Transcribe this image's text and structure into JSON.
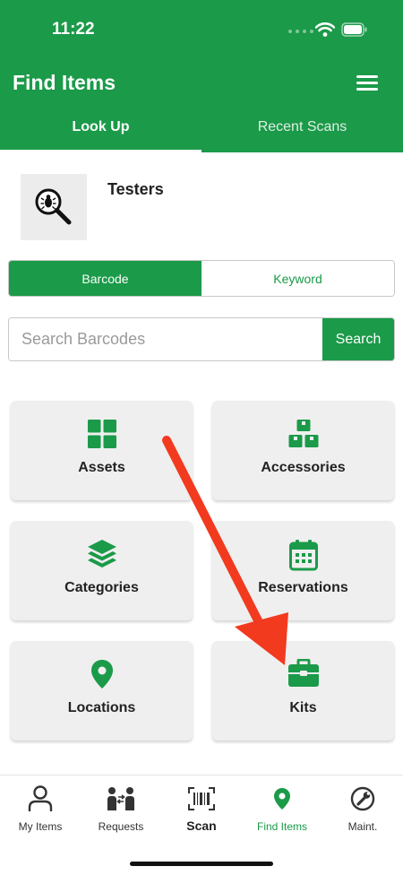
{
  "status_bar": {
    "time": "11:22"
  },
  "header": {
    "title": "Find Items"
  },
  "tabs": [
    {
      "label": "Look Up",
      "active": true
    },
    {
      "label": "Recent Scans",
      "active": false
    }
  ],
  "organization": {
    "name": "Testers",
    "icon": "bug-magnifier-icon"
  },
  "segment": [
    {
      "label": "Barcode",
      "active": true
    },
    {
      "label": "Keyword",
      "active": false
    }
  ],
  "search": {
    "placeholder": "Search Barcodes",
    "value": "",
    "button_label": "Search"
  },
  "tiles": [
    {
      "label": "Assets",
      "icon": "grid-icon"
    },
    {
      "label": "Accessories",
      "icon": "boxes-icon"
    },
    {
      "label": "Categories",
      "icon": "layers-icon"
    },
    {
      "label": "Reservations",
      "icon": "calendar-icon"
    },
    {
      "label": "Locations",
      "icon": "map-pin-icon"
    },
    {
      "label": "Kits",
      "icon": "toolbox-icon"
    }
  ],
  "bottom_nav": [
    {
      "label": "My Items",
      "icon": "person-icon"
    },
    {
      "label": "Requests",
      "icon": "exchange-people-icon"
    },
    {
      "label": "Scan",
      "icon": "barcode-scan-icon"
    },
    {
      "label": "Find Items",
      "icon": "map-pin-icon",
      "active": true
    },
    {
      "label": "Maint.",
      "icon": "wrench-icon"
    }
  ],
  "colors": {
    "brand_green": "#1b9a49",
    "arrow_red": "#f23a1f",
    "tile_bg": "#efefef"
  }
}
